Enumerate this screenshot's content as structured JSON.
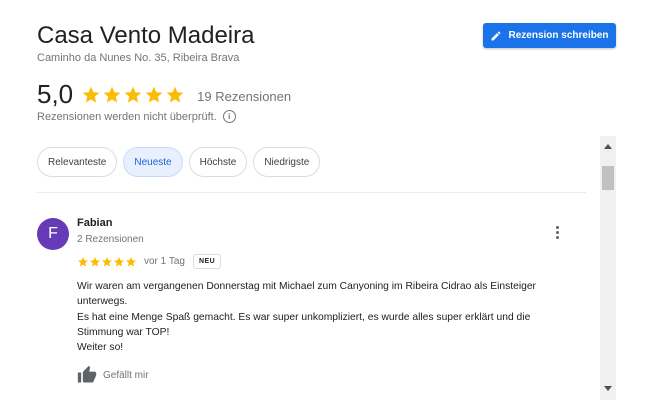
{
  "place": {
    "title": "Casa Vento Madeira",
    "address": "Caminho da Nunes No. 35, Ribeira Brava"
  },
  "write_review_button": {
    "label": "Rezension schreiben",
    "icon": "pencil-icon"
  },
  "rating": {
    "value": "5,0",
    "stars": 5,
    "count_label": "19 Rezensionen",
    "disclaimer": "Rezensionen werden nicht überprüft.",
    "info_icon_glyph": "i"
  },
  "sort_chips": [
    {
      "label": "Relevanteste",
      "selected": false
    },
    {
      "label": "Neueste",
      "selected": true
    },
    {
      "label": "Höchste",
      "selected": false
    },
    {
      "label": "Niedrigste",
      "selected": false
    }
  ],
  "review": {
    "avatar_letter": "F",
    "avatar_color": "#673ab7",
    "author": "Fabian",
    "author_reviews": "2 Rezensionen",
    "stars": 5,
    "age": "vor 1 Tag",
    "badge": "NEU",
    "text_lines": [
      "Wir waren am vergangenen Donnerstag mit Michael zum Canyoning im Ribeira Cidrao als Einsteiger unterwegs.",
      "Es hat eine Menge Spaß gemacht. Es war super unkompliziert, es wurde alles super erklärt und die Stimmung war TOP!",
      "Weiter so!"
    ],
    "like_label": "Gefällt mir"
  },
  "colors": {
    "accent": "#1a73e8",
    "star": "#fbbc04",
    "selected_chip_bg": "#e8f0fe",
    "selected_chip_text": "#1967d2"
  }
}
